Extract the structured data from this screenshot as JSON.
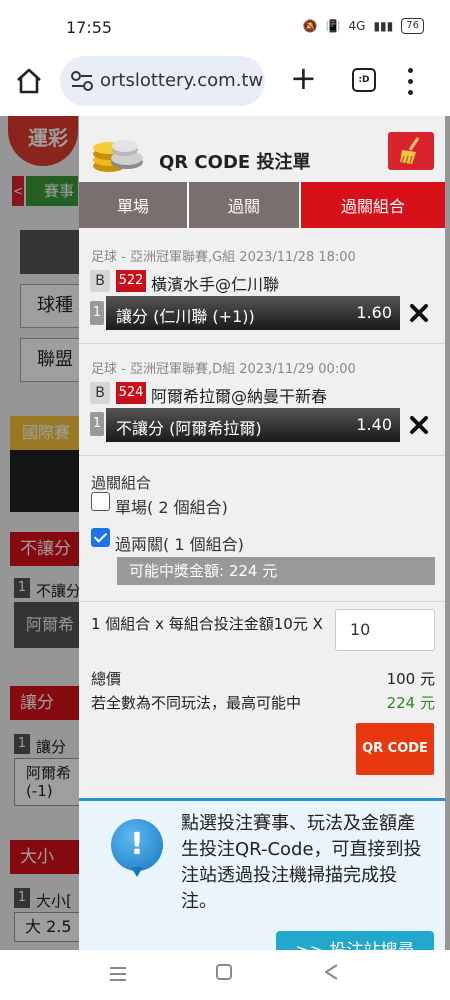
{
  "status_bar": {
    "time": "17:55",
    "signal": "4G",
    "battery": "76"
  },
  "browser": {
    "url": "ortslottery.com.tw",
    "tabs_label": ":D"
  },
  "background_page": {
    "logo_text": "運彩",
    "tab_label": "賽事",
    "filter_sport": "球種",
    "filter_league": "聯盟",
    "section_international": "國際賽",
    "section_no_handicap": "不讓分",
    "no_handicap_item": "不讓分",
    "no_handicap_pick": "阿爾希",
    "section_handicap": "讓分",
    "handicap_item": "讓分",
    "handicap_pick": "阿爾希",
    "handicap_line": "(-1)",
    "section_over_under": "大小",
    "over_under_item": "大小[",
    "over_under_pick": "大 2.5",
    "num_one": "1"
  },
  "modal": {
    "title": "QR CODE 投注單",
    "tabs": [
      {
        "label": "單場",
        "active": false
      },
      {
        "label": "過關",
        "active": false
      },
      {
        "label": "過關組合",
        "active": true
      }
    ],
    "bets": [
      {
        "info": "足球 - 亞洲冠軍聯賽,G組 2023/11/28 18:00",
        "type_tag": "B",
        "number": "522",
        "teams": "橫濱水手@仁川聯",
        "seq": "1",
        "pick": "讓分 (仁川聯 (+1))",
        "odds": "1.60"
      },
      {
        "info": "足球 - 亞洲冠軍聯賽,D組 2023/11/29 00:00",
        "type_tag": "B",
        "number": "524",
        "teams": "阿爾希拉爾@納曼干新春",
        "seq": "1",
        "pick": "不讓分 (阿爾希拉爾)",
        "odds": "1.40"
      }
    ],
    "combo": {
      "title": "過關組合",
      "options": [
        {
          "label": "單場( 2 個組合)",
          "checked": false
        },
        {
          "label": "過兩關( 1 個組合)",
          "checked": true
        }
      ],
      "possible_win": "可能中獎金額: 224 元"
    },
    "stake": {
      "line": "1 個組合 x 每組合投注金額10元 X",
      "value": "10"
    },
    "total_label": "總價",
    "total_value": "100 元",
    "max_win_label": "若全數為不同玩法，最高可能中",
    "max_win_value": "224 元",
    "qr_button": "QR CODE",
    "info_text": "點選投注賽事、玩法及金額產生投注QR-Code，可直接到投注站透過投注機掃描完成投注。",
    "info_icon": "!",
    "search_button": ">> 投注站搜尋"
  },
  "colors": {
    "accent_red": "#d7111a",
    "tab_inactive": "#7a6f6f",
    "win_green": "#2a8a1a",
    "qr_orange": "#e8380f",
    "info_blue": "#2592cf"
  }
}
